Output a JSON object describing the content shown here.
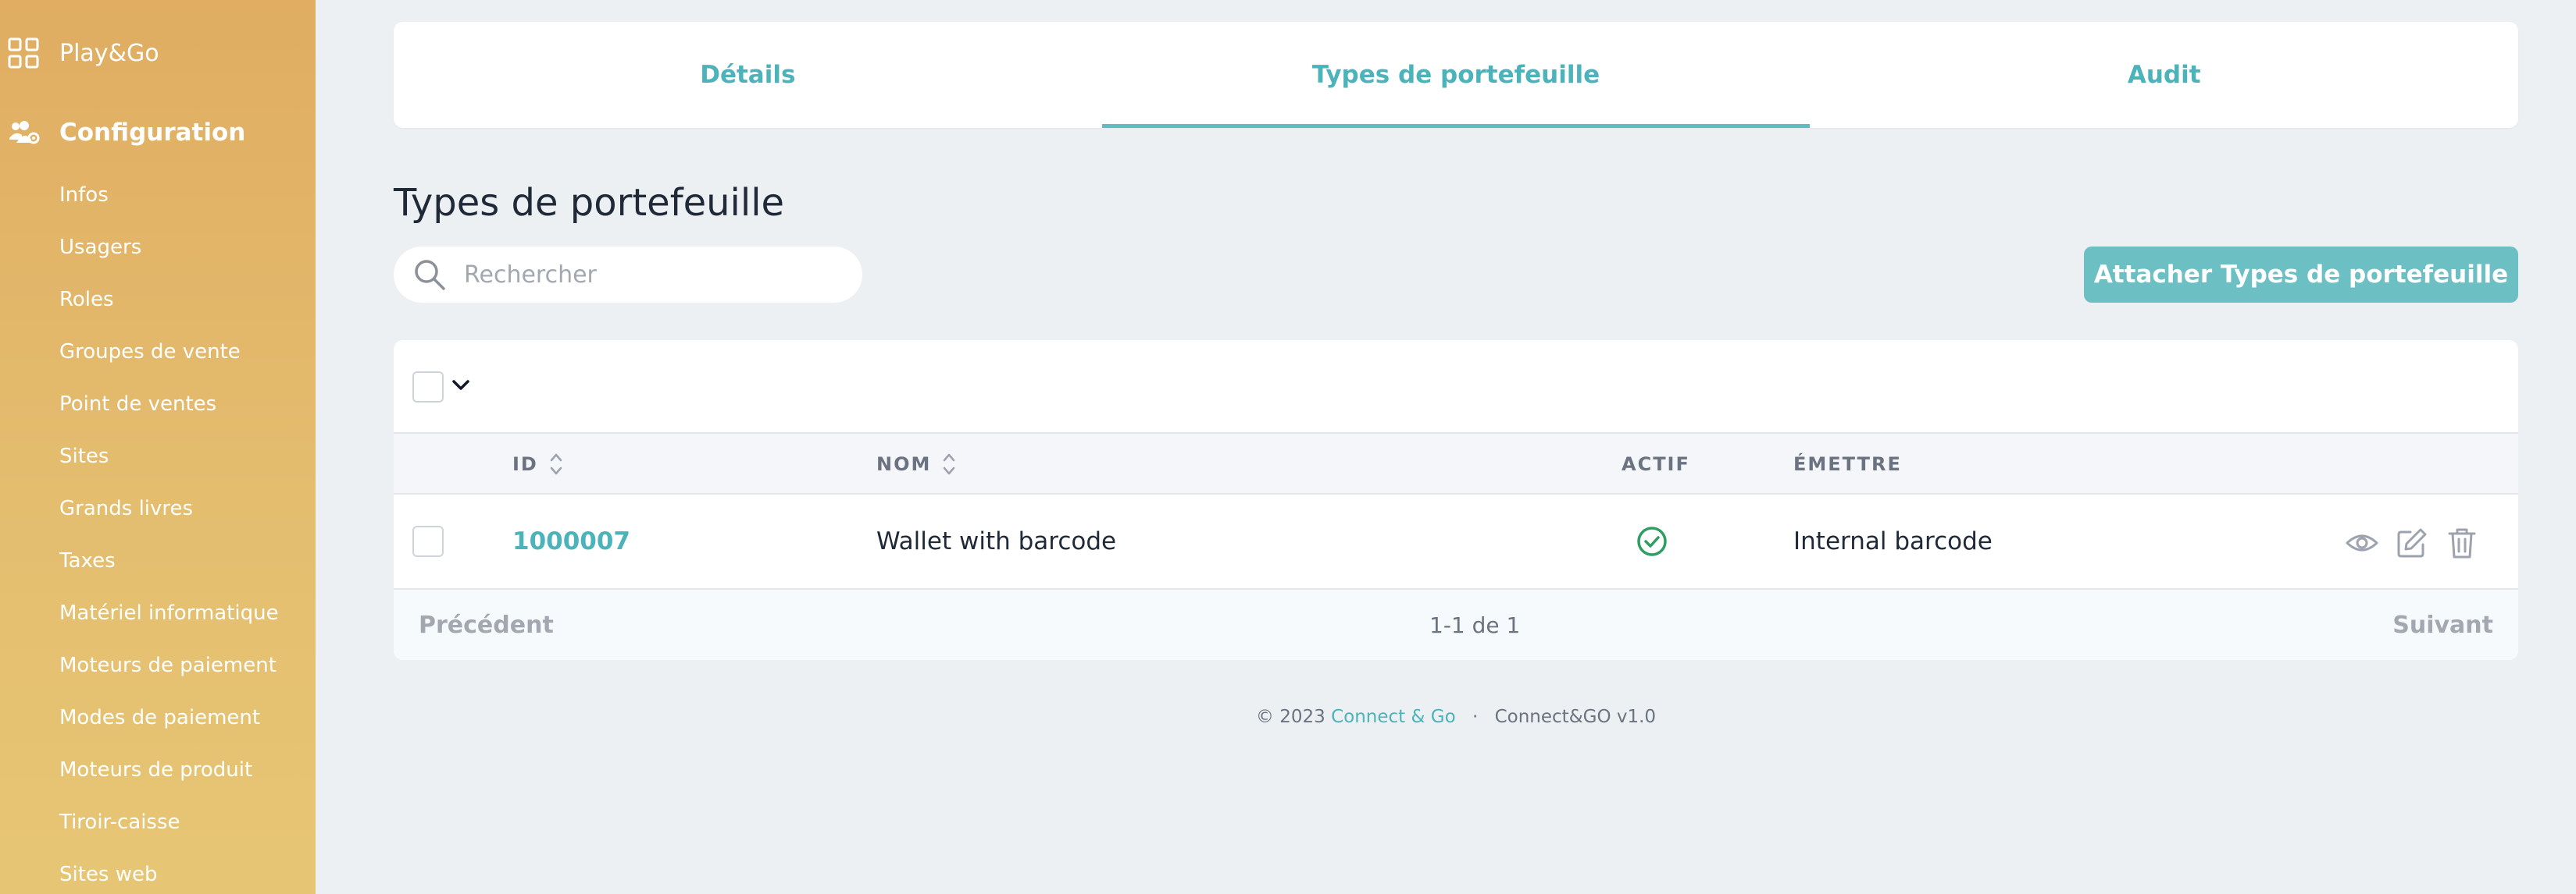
{
  "sidebar": {
    "brand": "Play&Go",
    "section": "Configuration",
    "items": [
      {
        "label": "Infos"
      },
      {
        "label": "Usagers"
      },
      {
        "label": "Roles"
      },
      {
        "label": "Groupes de vente"
      },
      {
        "label": "Point de ventes"
      },
      {
        "label": "Sites"
      },
      {
        "label": "Grands livres"
      },
      {
        "label": "Taxes"
      },
      {
        "label": "Matériel informatique"
      },
      {
        "label": "Moteurs de paiement"
      },
      {
        "label": "Modes de paiement"
      },
      {
        "label": "Moteurs de produit"
      },
      {
        "label": "Tiroir-caisse"
      },
      {
        "label": "Sites web"
      }
    ]
  },
  "tabs": [
    {
      "label": "Détails",
      "active": false
    },
    {
      "label": "Types de portefeuille",
      "active": true
    },
    {
      "label": "Audit",
      "active": false
    }
  ],
  "page": {
    "title": "Types de portefeuille",
    "search_placeholder": "Rechercher",
    "search_value": "",
    "attach_label": "Attacher Types de portefeuille"
  },
  "table": {
    "columns": {
      "id": "ID",
      "nom": "NOM",
      "actif": "ACTIF",
      "emettre": "ÉMETTRE"
    },
    "rows": [
      {
        "id": "1000007",
        "nom": "Wallet with barcode",
        "actif": true,
        "emettre": "Internal barcode"
      }
    ],
    "pagination": {
      "prev": "Précédent",
      "count": "1-1 de 1",
      "next": "Suivant"
    }
  },
  "footer": {
    "copyright": "© 2023",
    "company": "Connect & Go",
    "separator": "·",
    "version": "Connect&GO v1.0"
  },
  "colors": {
    "accent": "#4bb3b9",
    "button": "#6cc0c3",
    "success": "#2f9e62",
    "sidebar_top": "#e0ad62",
    "sidebar_bottom": "#e6c674"
  }
}
